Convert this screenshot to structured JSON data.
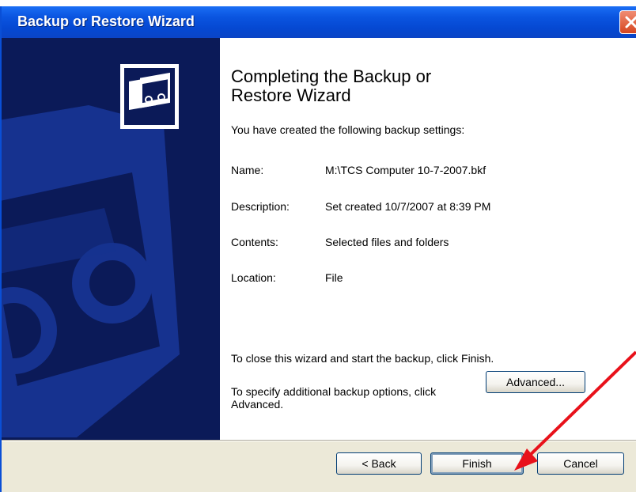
{
  "window": {
    "title": "Backup or Restore Wizard"
  },
  "content": {
    "heading_line1": "Completing the Backup or",
    "heading_line2": "Restore Wizard",
    "intro": "You have created the following backup settings:",
    "settings": [
      {
        "label": "Name:",
        "value": "M:\\TCS Computer 10-7-2007.bkf"
      },
      {
        "label": "Description:",
        "value": "Set created 10/7/2007 at 8:39 PM"
      },
      {
        "label": "Contents:",
        "value": "Selected files and folders"
      },
      {
        "label": "Location:",
        "value": "File"
      }
    ],
    "close_note": "To close this wizard and start the backup, click Finish.",
    "options_note": "To specify additional backup options, click Advanced.",
    "advanced_label": "Advanced..."
  },
  "buttons": {
    "back_label": "< Back",
    "finish_label": "Finish",
    "cancel_label": "Cancel"
  },
  "colors": {
    "titlebar": "#0a54df",
    "side_panel": "#0b1a58",
    "annotation_arrow": "#e8111a"
  }
}
